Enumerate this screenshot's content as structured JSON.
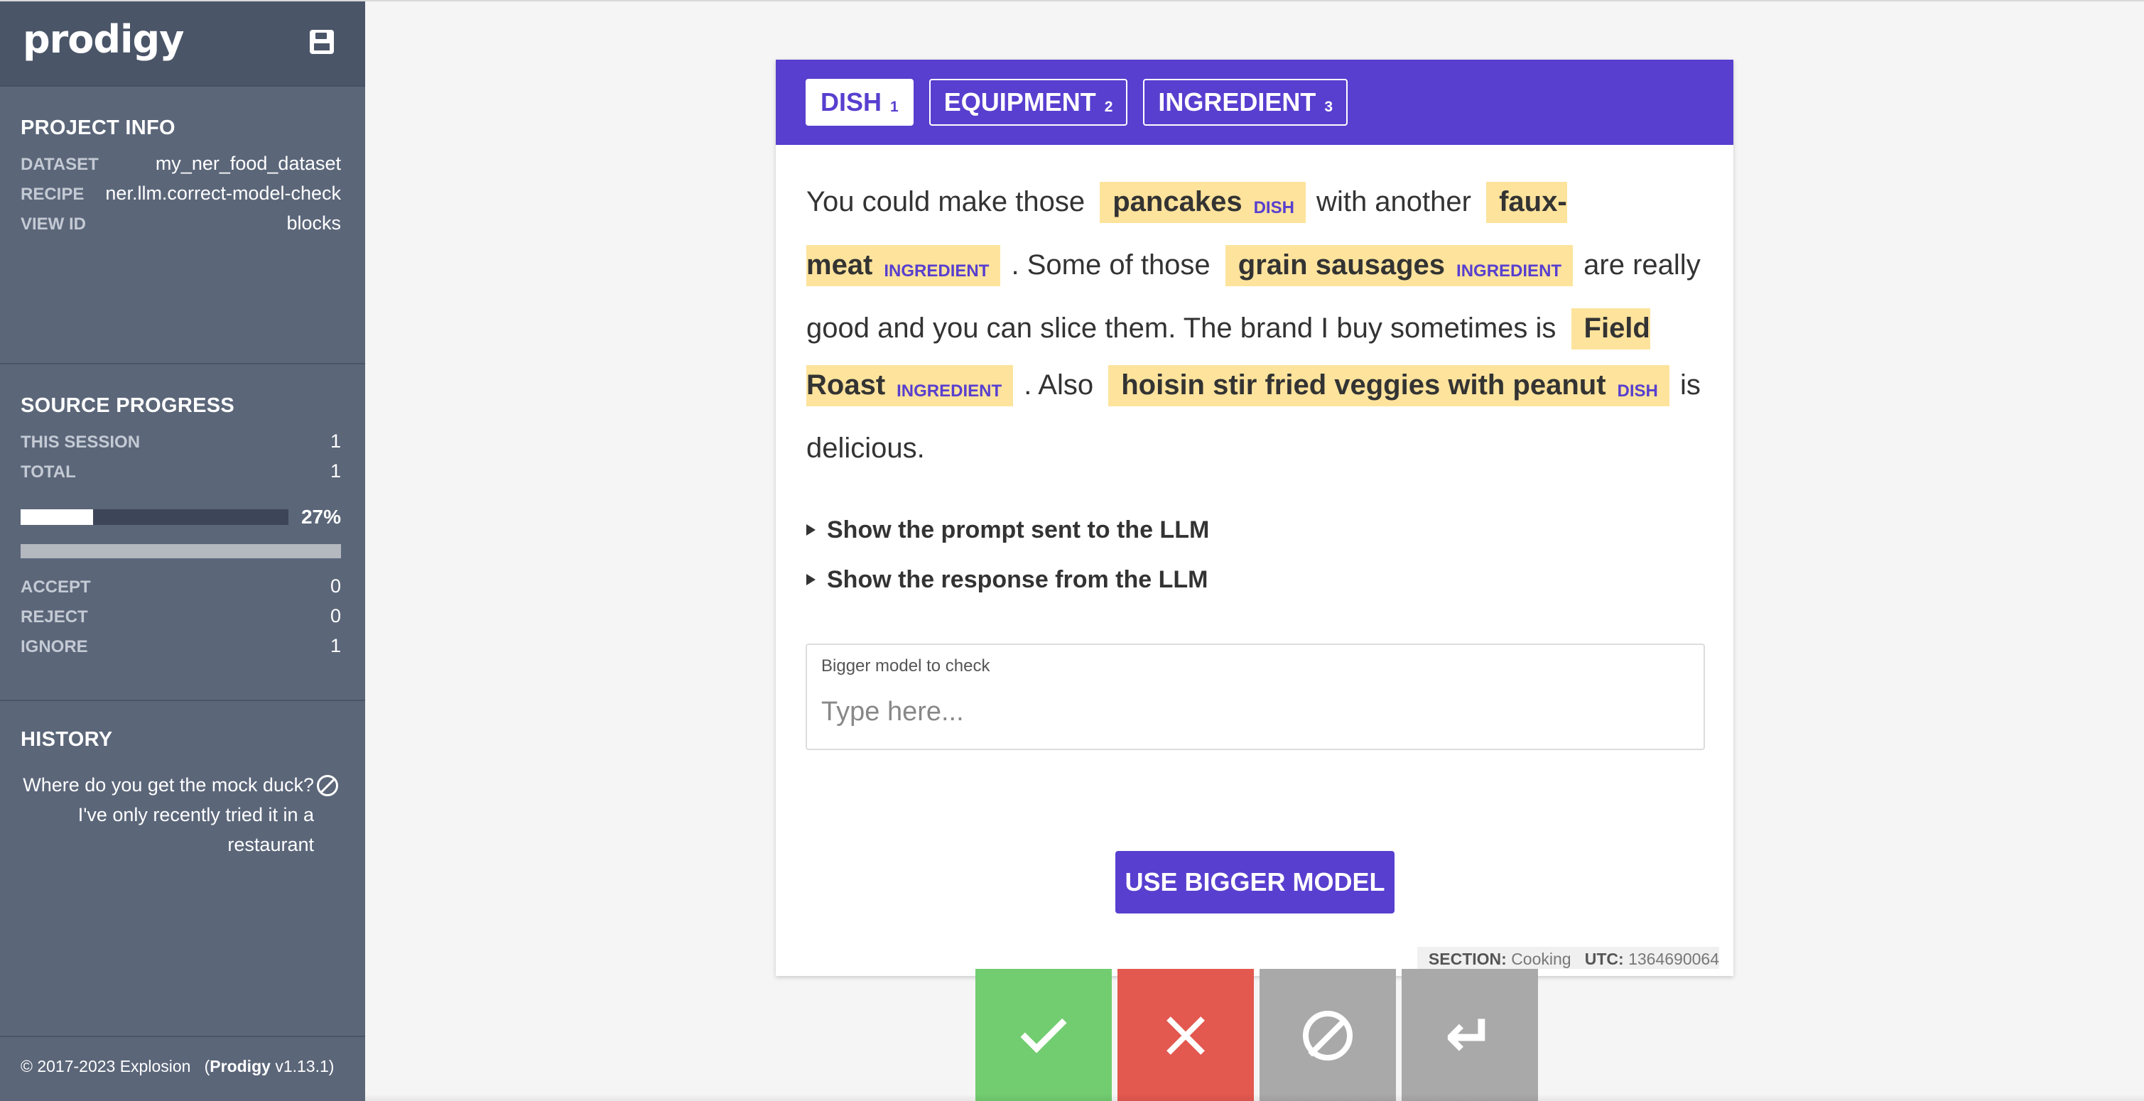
{
  "app": {
    "logo": "prodigy",
    "save_icon": "save-icon"
  },
  "project_info": {
    "title": "Project Info",
    "rows": [
      {
        "key": "Dataset",
        "value": "my_ner_food_dataset"
      },
      {
        "key": "Recipe",
        "value": "ner.llm.correct-model-check"
      },
      {
        "key": "View ID",
        "value": "blocks"
      }
    ]
  },
  "source_progress": {
    "title": "Source Progress",
    "rows": [
      {
        "key": "This Session",
        "value": "1"
      },
      {
        "key": "Total",
        "value": "1"
      }
    ],
    "progress_percent": 27,
    "progress_label": "27%",
    "counts": [
      {
        "key": "Accept",
        "value": "0"
      },
      {
        "key": "Reject",
        "value": "0"
      },
      {
        "key": "Ignore",
        "value": "1"
      }
    ]
  },
  "history": {
    "title": "History",
    "items": [
      {
        "text": "Where do you get the mock duck? I've only recently tried it in a restaurant",
        "status_icon": "ignore-icon"
      }
    ]
  },
  "footer": {
    "copyright": "© 2017-2023 Explosion",
    "product": "Prodigy",
    "version": "v1.13.1"
  },
  "labels": [
    {
      "name": "DISH",
      "key": "1",
      "selected": true
    },
    {
      "name": "EQUIPMENT",
      "key": "2",
      "selected": false
    },
    {
      "name": "INGREDIENT",
      "key": "3",
      "selected": false
    }
  ],
  "ner": {
    "segments": [
      {
        "text": "You could make those "
      },
      {
        "text": "pancakes",
        "label": "DISH"
      },
      {
        "text": " with another "
      },
      {
        "text": "faux-meat",
        "label": "INGREDIENT"
      },
      {
        "text": " . Some of those "
      },
      {
        "text": "grain sausages",
        "label": "INGREDIENT"
      },
      {
        "text": " are really good and you can slice them. The brand I buy sometimes is "
      },
      {
        "text": "Field Roast",
        "label": "INGREDIENT"
      },
      {
        "text": " . Also "
      },
      {
        "text": "hoisin stir fried veggies with peanut",
        "label": "DISH"
      },
      {
        "text": " is delicious."
      }
    ]
  },
  "details": {
    "prompt_toggle": "Show the prompt sent to the LLM",
    "response_toggle": "Show the response from the LLM"
  },
  "field": {
    "label": "Bigger model to check",
    "placeholder": "Type here...",
    "value": ""
  },
  "button": {
    "label": "Use bigger model"
  },
  "meta": {
    "section_key": "SECTION:",
    "section_value": "Cooking",
    "utc_key": "UTC:",
    "utc_value": "1364690064"
  },
  "actions": [
    {
      "name": "accept",
      "icon": "check-icon",
      "color": "#72cc70"
    },
    {
      "name": "reject",
      "icon": "x-icon",
      "color": "#e3584f"
    },
    {
      "name": "ignore",
      "icon": "ignore-icon",
      "color": "#a9a9a9"
    },
    {
      "name": "undo",
      "icon": "undo-icon",
      "color": "#a9a9a9"
    }
  ],
  "colors": {
    "accent": "#583fcf",
    "sidebar_bg": "#5b6679",
    "sidebar_header_bg": "#4a5568",
    "entity_highlight": "#fde39c"
  }
}
